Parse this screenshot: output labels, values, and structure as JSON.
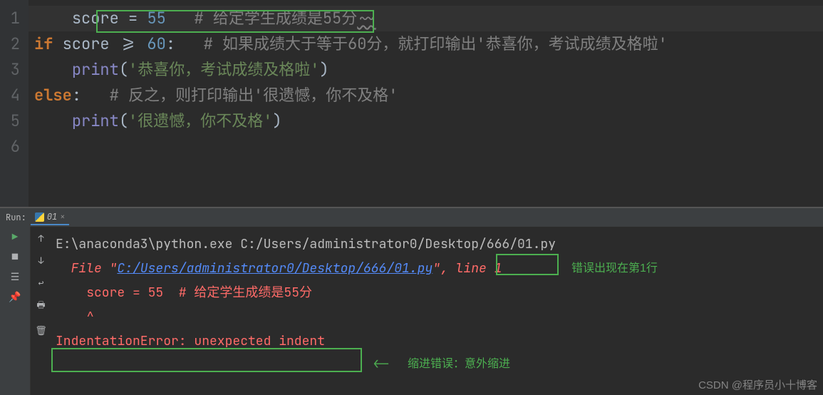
{
  "editor": {
    "lineNumbers": [
      "1",
      "2",
      "3",
      "4",
      "5",
      "6"
    ],
    "l1_ident": "score",
    "l1_op": " = ",
    "l1_num": "55",
    "l1_cmt": "   # 给定学生成绩是55分",
    "l2_if": "if",
    "l2_ident": " score ",
    "l2_op": ">= ",
    "l2_num": "60",
    "l2_colon": ":",
    "l2_cmt": "   # 如果成绩大于等于60分，就打印输出'恭喜你，考试成绩及格啦'",
    "l3_print": "print",
    "l3_par1": "(",
    "l3_str": "'恭喜你，考试成绩及格啦'",
    "l3_par2": ")",
    "l4_else": "else",
    "l4_colon": ":",
    "l4_cmt": "   # 反之，则打印输出'很遗憾，你不及格'",
    "l5_print": "print",
    "l5_par1": "(",
    "l5_str": "'很遗憾，你不及格'",
    "l5_par2": ")"
  },
  "run": {
    "label": "Run:",
    "tab": "01",
    "close": "×",
    "line1": "E:\\anaconda3\\python.exe C:/Users/administrator0/Desktop/666/01.py",
    "line2_pre": "  File \"",
    "line2_link": "C:/Users/administrator0/Desktop/666/01.py",
    "line2_mid": "\", ",
    "line2_ln": "line 1",
    "line3": "    score = 55  # 给定学生成绩是55分",
    "line4": "    ^",
    "line5": "IndentationError: unexpected indent"
  },
  "icons": {
    "play": "▶",
    "up": "↑",
    "stop": "■",
    "down": "↓",
    "bar": "☰",
    "wrap": "↩",
    "pin": "📌",
    "print": "🖶",
    "trash": "🗑"
  },
  "annotations": {
    "anno1": "错误出现在第1行",
    "anno2": "缩进错误：意外缩进",
    "arrow": "⟵"
  },
  "watermark": "CSDN @程序员小十博客"
}
